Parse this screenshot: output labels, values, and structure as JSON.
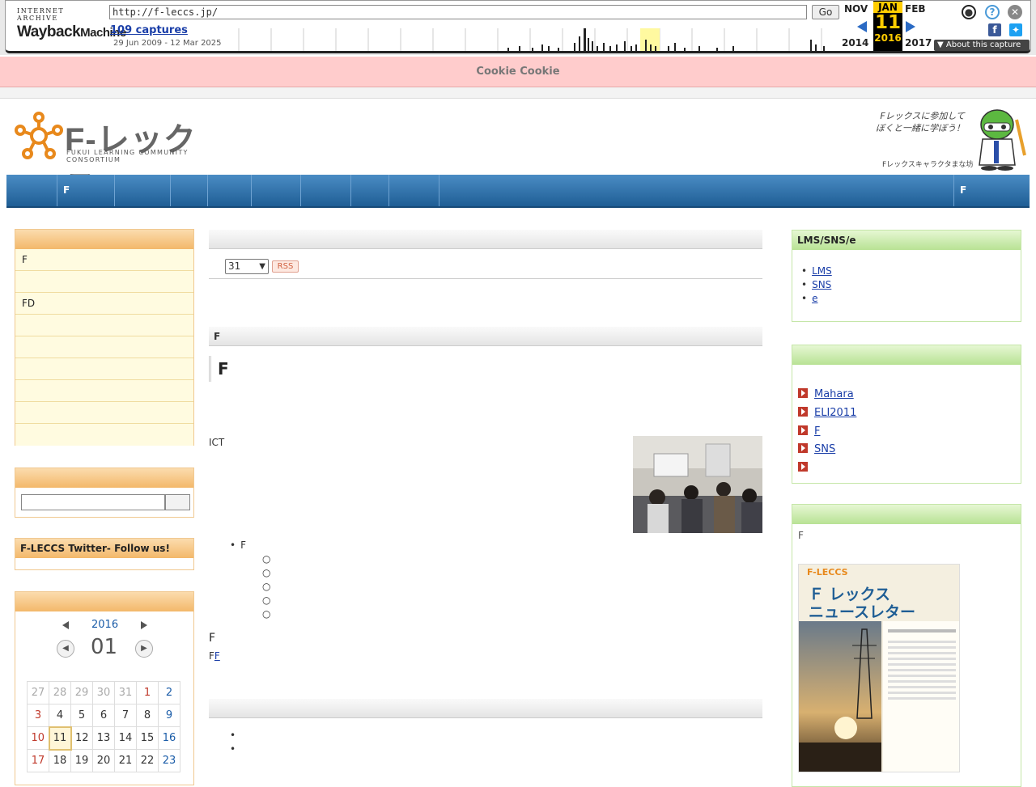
{
  "wayback": {
    "logo_top": "INTERNET ARCHIVE",
    "logo_wayback": "Wayback",
    "logo_machine": "Machine",
    "url": "http://f-leccs.jp/",
    "go": "Go",
    "captures": "109 captures",
    "range": "29 Jun 2009 - 12 Mar 2025",
    "prev_month": "NOV",
    "prev_year": "2014",
    "cur_month": "JAN",
    "cur_day": "11",
    "cur_year": "2016",
    "next_month": "FEB",
    "next_year": "2017",
    "about": "About this capture"
  },
  "cookie": "Cookie Cookie",
  "notice": "",
  "header": {
    "logo_text": "F-レックス",
    "logo_sub": "FUKUI LEARNING COMMUNITY CONSORTIUM",
    "speech_1": "Fレックスに参加して",
    "speech_2": "ぼくと一緒に学ぼう！",
    "mascot_caption": "Fレックスキャラクタまな坊"
  },
  "nav": {
    "items": [
      "",
      "F",
      "",
      "",
      "",
      "",
      "",
      "",
      ""
    ],
    "right": "F"
  },
  "left": {
    "cat_title": "",
    "cat_items": [
      "F",
      "",
      "FD",
      "",
      "",
      "",
      "",
      "",
      ""
    ],
    "search_title": "",
    "search_button": "",
    "twitter_title": "F-LECCS Twitter- Follow us!",
    "cal_title": "",
    "cal_year": "2016",
    "cal_month": "01",
    "cal_weekdays": [
      "",
      "",
      "",
      "",
      "",
      "",
      ""
    ],
    "cal_rows": [
      [
        "27",
        "28",
        "29",
        "30",
        "31",
        "1",
        "2"
      ],
      [
        "3",
        "4",
        "5",
        "6",
        "7",
        "8",
        "9"
      ],
      [
        "10",
        "11",
        "12",
        "13",
        "14",
        "15",
        "16"
      ],
      [
        "17",
        "18",
        "19",
        "20",
        "21",
        "22",
        "23"
      ]
    ]
  },
  "main": {
    "box1_title": "",
    "select_label": "",
    "select_value": "31",
    "rss": "RSS",
    "box1_text": "",
    "box2_title": "F",
    "h1": "F",
    "h2": "",
    "p1_pre": "",
    "p1_link": "",
    "p1_post": "",
    "p2": "ICT",
    "p3": "",
    "list_head": "F",
    "list_items": [
      "",
      "",
      "",
      "",
      ""
    ],
    "h2b": "F",
    "p4_pre": "F",
    "p4_link": "F",
    "p4_post": "",
    "box3_title": "",
    "box3_links": [
      "",
      ""
    ]
  },
  "right": {
    "lms_title": "LMS/SNS/e",
    "lms_links": [
      "LMS",
      "SNS",
      "e"
    ],
    "news_title": "",
    "news_more": "",
    "news_items": [
      "Mahara",
      "ELI2011 ",
      "F",
      "SNS",
      ""
    ],
    "nl_title": "",
    "nl_text_1": "F",
    "nl_text_2": "",
    "nl_img_title_1": "Ｆ レックス",
    "nl_img_title_2": "ニュースレター",
    "nl_img_brand": "F-LECCS"
  },
  "colors": {
    "nav_blue": "#2a6aa3",
    "cookie_pink": "#ffcccc",
    "left_orange": "#f3b86a",
    "right_green": "#b8e294"
  }
}
